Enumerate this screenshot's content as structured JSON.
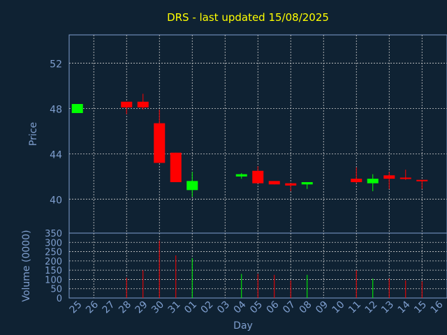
{
  "title": "DRS - last updated 15/08/2025",
  "colors": {
    "background": "#0f2233",
    "axis_text": "#7f9fcf",
    "title": "#ffff00",
    "up": "#00ff00",
    "down": "#ff0000",
    "grid": "#d0d0d0"
  },
  "chart_data": [
    {
      "type": "candlestick",
      "ylabel": "Price",
      "ylim": [
        37,
        54.5
      ],
      "yticks": [
        40,
        44,
        48,
        52
      ],
      "grid": true,
      "categories": [
        "25",
        "26",
        "27",
        "28",
        "29",
        "30",
        "31",
        "01",
        "02",
        "03",
        "04",
        "05",
        "06",
        "07",
        "08",
        "09",
        "10",
        "11",
        "12",
        "13",
        "14",
        "15",
        "16"
      ],
      "candles": [
        {
          "day": "25",
          "open": 47.6,
          "close": 48.4,
          "high": 48.4,
          "low": 47.6
        },
        {
          "day": "28",
          "open": 48.6,
          "close": 48.1,
          "high": 48.6,
          "low": 47.5
        },
        {
          "day": "29",
          "open": 48.6,
          "close": 48.1,
          "high": 49.3,
          "low": 47.9
        },
        {
          "day": "30",
          "open": 46.7,
          "close": 43.2,
          "high": 47.9,
          "low": 43.2
        },
        {
          "day": "31",
          "open": 44.1,
          "close": 41.5,
          "high": 44.1,
          "low": 41.5
        },
        {
          "day": "01",
          "open": 40.8,
          "close": 41.6,
          "high": 42.4,
          "low": 40.2
        },
        {
          "day": "04",
          "open": 42.0,
          "close": 42.2,
          "high": 42.3,
          "low": 41.8
        },
        {
          "day": "05",
          "open": 42.5,
          "close": 41.4,
          "high": 42.9,
          "low": 41.4
        },
        {
          "day": "06",
          "open": 41.6,
          "close": 41.3,
          "high": 41.6,
          "low": 41.3
        },
        {
          "day": "07",
          "open": 41.4,
          "close": 41.2,
          "high": 41.4,
          "low": 40.7
        },
        {
          "day": "08",
          "open": 41.3,
          "close": 41.5,
          "high": 41.5,
          "low": 40.9
        },
        {
          "day": "11",
          "open": 41.8,
          "close": 41.5,
          "high": 42.8,
          "low": 41.4
        },
        {
          "day": "12",
          "open": 41.4,
          "close": 41.8,
          "high": 42.2,
          "low": 40.7
        },
        {
          "day": "13",
          "open": 42.1,
          "close": 41.8,
          "high": 42.4,
          "low": 40.9
        },
        {
          "day": "14",
          "open": 41.9,
          "close": 41.8,
          "high": 42.6,
          "low": 41.7
        },
        {
          "day": "15",
          "open": 41.7,
          "close": 41.6,
          "high": 41.7,
          "low": 40.9
        }
      ]
    },
    {
      "type": "bar",
      "ylabel": "Volume (0000)",
      "xlabel": "Day",
      "ylim": [
        0,
        350
      ],
      "yticks": [
        0,
        50,
        100,
        150,
        200,
        250,
        300,
        350
      ],
      "grid": true,
      "categories": [
        "25",
        "26",
        "27",
        "28",
        "29",
        "30",
        "31",
        "01",
        "02",
        "03",
        "04",
        "05",
        "06",
        "07",
        "08",
        "09",
        "10",
        "11",
        "12",
        "13",
        "14",
        "15",
        "16"
      ],
      "bars": [
        {
          "day": "28",
          "value": 110,
          "dir": "down"
        },
        {
          "day": "29",
          "value": 150,
          "dir": "down"
        },
        {
          "day": "30",
          "value": 310,
          "dir": "down"
        },
        {
          "day": "31",
          "value": 230,
          "dir": "down"
        },
        {
          "day": "01",
          "value": 215,
          "dir": "up"
        },
        {
          "day": "04",
          "value": 130,
          "dir": "up"
        },
        {
          "day": "05",
          "value": 130,
          "dir": "down"
        },
        {
          "day": "06",
          "value": 125,
          "dir": "down"
        },
        {
          "day": "07",
          "value": 95,
          "dir": "down"
        },
        {
          "day": "08",
          "value": 125,
          "dir": "up"
        },
        {
          "day": "11",
          "value": 150,
          "dir": "down"
        },
        {
          "day": "12",
          "value": 105,
          "dir": "up"
        },
        {
          "day": "13",
          "value": 105,
          "dir": "down"
        },
        {
          "day": "14",
          "value": 95,
          "dir": "down"
        },
        {
          "day": "15",
          "value": 90,
          "dir": "down"
        }
      ]
    }
  ]
}
